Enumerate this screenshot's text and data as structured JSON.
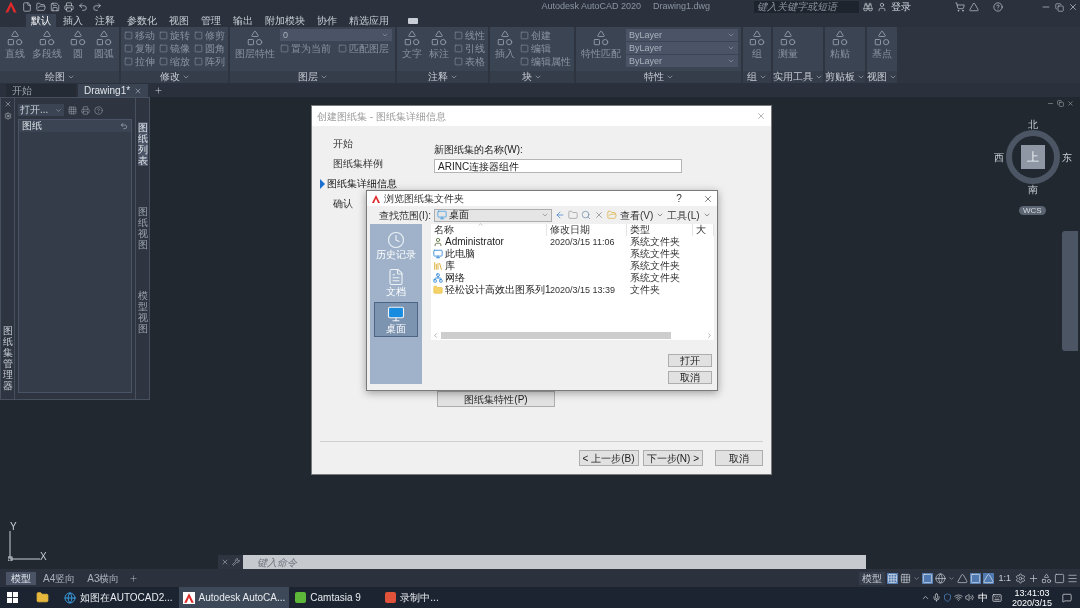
{
  "app": {
    "title": "Autodesk AutoCAD 2020",
    "document": "Drawing1.dwg"
  },
  "search": {
    "placeholder": "键入关键字或短语"
  },
  "sign_in": "登录",
  "ribbon_tabs": [
    {
      "label": "默认",
      "selected": true
    },
    {
      "label": "插入",
      "selected": false
    },
    {
      "label": "注释",
      "selected": false
    },
    {
      "label": "参数化",
      "selected": false
    },
    {
      "label": "视图",
      "selected": false
    },
    {
      "label": "管理",
      "selected": false
    },
    {
      "label": "输出",
      "selected": false
    },
    {
      "label": "附加模块",
      "selected": false
    },
    {
      "label": "协作",
      "selected": false
    },
    {
      "label": "精选应用",
      "selected": false
    }
  ],
  "ribbon_panels": [
    {
      "title": "绘图",
      "large": [
        "直线",
        "多段线",
        "圆",
        "圆弧"
      ]
    },
    {
      "title": "修改",
      "small": [
        "移动",
        "旋转",
        "修剪",
        "复制",
        "镜像",
        "圆角",
        "拉伸",
        "缩放",
        "阵列"
      ]
    },
    {
      "title": "图层",
      "large": [
        "图层特性"
      ],
      "dropdowns": [
        "0"
      ],
      "small": [
        "置为当前",
        "匹配图层"
      ]
    },
    {
      "title": "注释",
      "large": [
        "文字",
        "标注"
      ],
      "small": [
        "线性",
        "引线",
        "表格"
      ]
    },
    {
      "title": "块",
      "large": [
        "插入"
      ],
      "small": [
        "创建",
        "编辑",
        "编辑属性"
      ]
    },
    {
      "title": "特性",
      "large": [
        "特性匹配"
      ],
      "dropdowns": [
        "ByLayer",
        "ByLayer",
        "ByLayer"
      ]
    },
    {
      "title": "组",
      "large": [
        "组"
      ]
    },
    {
      "title": "实用工具",
      "large": [
        "测量"
      ]
    },
    {
      "title": "剪贴板",
      "large": [
        "粘贴"
      ]
    },
    {
      "title": "视图",
      "large": [
        "基点"
      ]
    }
  ],
  "doc_tabs": [
    {
      "label": "开始",
      "selected": false,
      "closable": false
    },
    {
      "label": "Drawing1*",
      "selected": true,
      "closable": true
    }
  ],
  "palette": {
    "title": "图纸集管理器",
    "dropdown": "打开...",
    "header": "图纸",
    "tabs": [
      {
        "label": "图纸列表",
        "selected": true
      },
      {
        "label": "图纸视图",
        "selected": false
      },
      {
        "label": "模型视图",
        "selected": false
      }
    ]
  },
  "viewcube": {
    "north": "北",
    "west": "西",
    "top": "上",
    "east": "东",
    "south": "南",
    "ucs": "WCS"
  },
  "ucs_axes": {
    "x": "X",
    "y": "Y"
  },
  "command_line": {
    "placeholder": "键入命令"
  },
  "layout_tabs": [
    {
      "label": "模型",
      "selected": true
    },
    {
      "label": "A4竖向",
      "selected": false
    },
    {
      "label": "A3横向",
      "selected": false
    }
  ],
  "status_bar": {
    "space": "模型",
    "scale": "1:1"
  },
  "taskbar": {
    "items": [
      {
        "label": "如图在AUTOCAD2...",
        "kind": "browser",
        "selected": false
      },
      {
        "label": "Autodesk AutoCA...",
        "kind": "autocad",
        "selected": true
      },
      {
        "label": "Camtasia 9",
        "kind": "camtasia",
        "selected": false
      },
      {
        "label": "录制中...",
        "kind": "recorder",
        "selected": false
      }
    ],
    "ime": "中",
    "time": "13:41:03",
    "date": "2020/3/15"
  },
  "sheet_set_dialog": {
    "title": "创建图纸集 - 图纸集详细信息",
    "steps": [
      {
        "label": "开始",
        "selected": false
      },
      {
        "label": "图纸集样例",
        "selected": false
      },
      {
        "label": "图纸集详细信息",
        "selected": true
      },
      {
        "label": "确认",
        "selected": false
      }
    ],
    "name_label": "新图纸集的名称(W):",
    "name_value": "ARINC连接器组件",
    "properties_button": "图纸集特性(P)",
    "buttons": [
      "< 上一步(B)",
      "下一步(N) >",
      "取消"
    ]
  },
  "browse_dialog": {
    "title": "浏览图纸集文件夹",
    "help": "?",
    "look_in_label": "查找范围(I):",
    "look_in": "桌面",
    "view_menu": "查看(V)",
    "tools_menu": "工具(L)",
    "places": [
      {
        "label": "历史记录",
        "kind": "history",
        "selected": false
      },
      {
        "label": "文档",
        "kind": "documents",
        "selected": false
      },
      {
        "label": "桌面",
        "kind": "desktop",
        "selected": true
      }
    ],
    "columns": [
      "名称",
      "修改日期",
      "类型",
      "大"
    ],
    "rows": [
      {
        "name": "Administrator",
        "kind": "user",
        "modified": "2020/3/15 11:06",
        "type": "系统文件夹"
      },
      {
        "name": "此电脑",
        "kind": "computer",
        "type": "系统文件夹"
      },
      {
        "name": "库",
        "kind": "library",
        "type": "系统文件夹"
      },
      {
        "name": "网络",
        "kind": "network",
        "type": "系统文件夹"
      },
      {
        "name": "轻松设计高效出图系列1",
        "kind": "folder",
        "modified": "2020/3/15 13:39",
        "type": "文件夹"
      }
    ],
    "buttons": [
      "打开",
      "取消"
    ]
  }
}
